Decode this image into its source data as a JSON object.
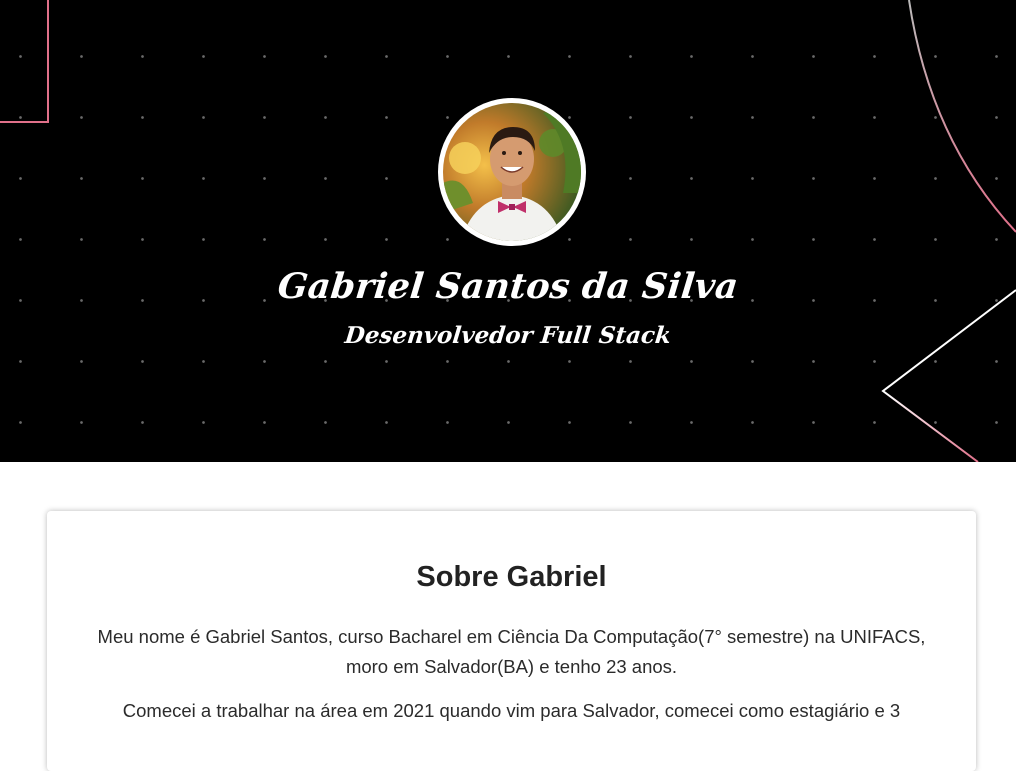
{
  "hero": {
    "name": "Gabriel Santos da Silva",
    "role": "Desenvolvedor Full Stack",
    "background_color": "#000000",
    "accent_color": "#e0708a"
  },
  "about": {
    "title": "Sobre Gabriel",
    "paragraph1_line1": "Meu nome é Gabriel Santos, curso Bacharel em Ciência Da Computação(7° semestre) na UNIFACS,",
    "paragraph1_line2": "moro em Salvador(BA) e tenho 23 anos.",
    "paragraph2_line1": "Comecei a trabalhar na área em 2021 quando vim para Salvador, comecei como estagiário e 3"
  },
  "icons": {
    "avatar": "profile-photo"
  }
}
